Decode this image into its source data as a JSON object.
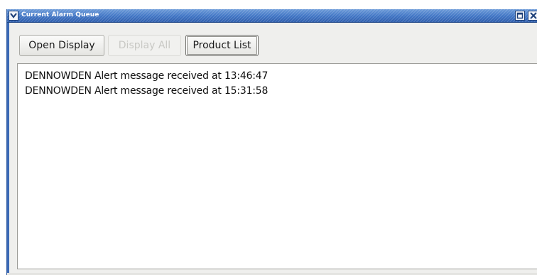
{
  "window": {
    "title": "Current Alarm Queue"
  },
  "toolbar": {
    "open_display_label": "Open Display",
    "display_all_label": "Display All",
    "product_list_label": "Product List"
  },
  "messages": [
    "DENNOWDEN Alert message received at 13:46:47",
    "DENNOWDEN Alert message received at 15:31:58"
  ],
  "colors": {
    "titlebar": "#3f74c4",
    "window_background": "#efefed",
    "list_background": "#ffffff",
    "disabled_text": "#c8c8c4"
  },
  "icons": {
    "window_menu": "chevron-down-icon",
    "maximize": "maximize-icon",
    "close": "close-icon"
  }
}
